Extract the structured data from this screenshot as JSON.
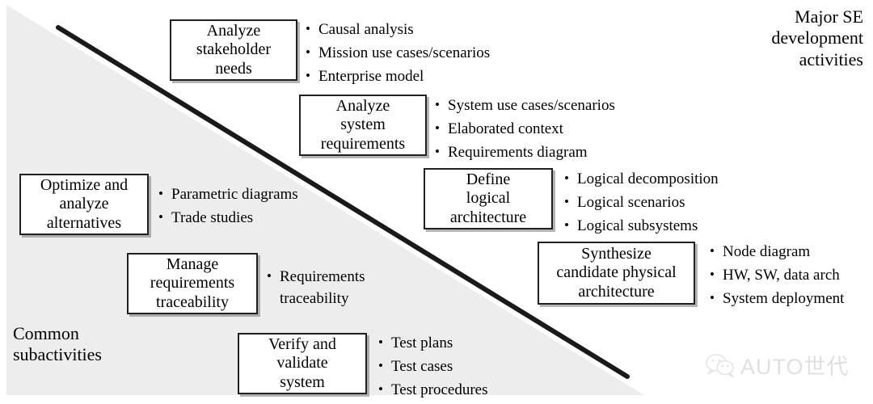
{
  "headings": {
    "top_right": "Major SE\ndevelopment\nactivities",
    "bottom_left": "Common\nsubactivities"
  },
  "activities": [
    {
      "id": "analyze-stakeholder-needs",
      "label": "Analyze\nstakeholder\nneeds",
      "bullets": [
        "Causal analysis",
        "Mission use cases/scenarios",
        "Enterprise model"
      ]
    },
    {
      "id": "analyze-system-requirements",
      "label": "Analyze\nsystem\nrequirements",
      "bullets": [
        "System use cases/scenarios",
        "Elaborated context",
        "Requirements diagram"
      ]
    },
    {
      "id": "define-logical-architecture",
      "label": "Define\nlogical\narchitecture",
      "bullets": [
        "Logical decomposition",
        "Logical scenarios",
        "Logical subsystems"
      ]
    },
    {
      "id": "synthesize-candidate-physical-architecture",
      "label": "Synthesize\ncandidate physical\narchitecture",
      "bullets": [
        "Node diagram",
        "HW, SW, data arch",
        "System deployment"
      ]
    },
    {
      "id": "optimize-and-analyze-alternatives",
      "label": "Optimize and\nanalyze\nalternatives",
      "bullets": [
        "Parametric diagrams",
        "Trade studies"
      ]
    },
    {
      "id": "manage-requirements-traceability",
      "label": "Manage\nrequirements\ntraceability",
      "bullets": [
        "Requirements\ntraceability"
      ]
    },
    {
      "id": "verify-and-validate-system",
      "label": "Verify and\nvalidate\nsystem",
      "bullets": [
        "Test plans",
        "Test cases",
        "Test procedures"
      ]
    }
  ],
  "bullet_glyph": "•",
  "watermark": {
    "icon": "wechat-icon",
    "text": "AUTO世代"
  },
  "colors": {
    "shade": "#ededed",
    "line": "#1a1a1a",
    "box_border": "#231f20",
    "box_fill": "#ffffff",
    "text": "#000000",
    "watermark": "#e0e0e0"
  }
}
